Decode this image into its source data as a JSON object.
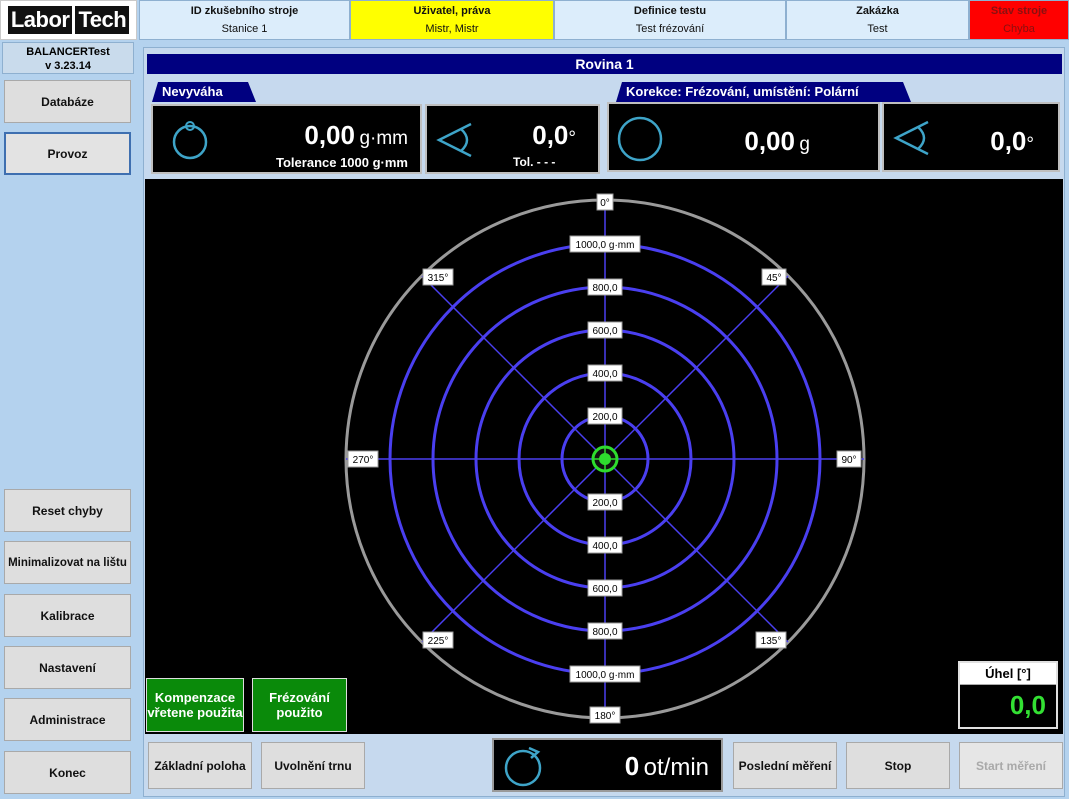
{
  "app": {
    "logo_part1": "Labor",
    "logo_part2": "Tech",
    "name": "BALANCERTest",
    "version": "v 3.23.14"
  },
  "sidebar": {
    "top": [
      {
        "label": "Databáze"
      },
      {
        "label": "Provoz"
      }
    ],
    "bottom": [
      {
        "label": "Reset chyby"
      },
      {
        "label": "Minimalizovat na lištu"
      },
      {
        "label": "Kalibrace"
      },
      {
        "label": "Nastavení"
      },
      {
        "label": "Administrace"
      },
      {
        "label": "Konec"
      }
    ]
  },
  "header": [
    {
      "title": "ID zkušebního stroje",
      "value": "Stanice 1"
    },
    {
      "title": "Uživatel, práva",
      "value": "Mistr, Mistr"
    },
    {
      "title": "Definice testu",
      "value": "Test frézování"
    },
    {
      "title": "Zakázka",
      "value": "Test"
    },
    {
      "title": "Stav stroje",
      "value": "Chyba"
    }
  ],
  "plane_title": "Rovina 1",
  "unbalance": {
    "tab": "Nevyváha",
    "value": "0,00",
    "unit": "g·mm",
    "tolerance": "Tolerance 1000  g·mm",
    "angle": "0,0",
    "angle_unit": "°",
    "angle_tol": "Tol. - - -"
  },
  "correction": {
    "tab": "Korekce: Frézování, umístění: Polární",
    "value": "0,00",
    "unit": "g",
    "angle": "0,0",
    "angle_unit": "°"
  },
  "polar": {
    "angle_labels": [
      "0°",
      "45°",
      "90°",
      "135°",
      "180°",
      "225°",
      "270°",
      "315°"
    ],
    "upper_ring_labels": [
      "1000,0 g·mm",
      "800,0",
      "600,0",
      "400,0",
      "200,0"
    ],
    "lower_ring_labels": [
      "200,0",
      "400,0",
      "600,0",
      "800,0",
      "1000,0 g·mm"
    ],
    "point_angle": 0,
    "point_value": 0
  },
  "badges": {
    "spindle": "Kompenzace vřetene použita",
    "milling": "Frézování použito"
  },
  "angle_display": {
    "label": "Úhel [°]",
    "value": "0,0"
  },
  "footer": {
    "home": "Základní poloha",
    "release": "Uvolnění trnu",
    "speed_value": "0",
    "speed_unit": "ot/min",
    "last": "Poslední měření",
    "stop": "Stop",
    "start": "Start měření"
  }
}
